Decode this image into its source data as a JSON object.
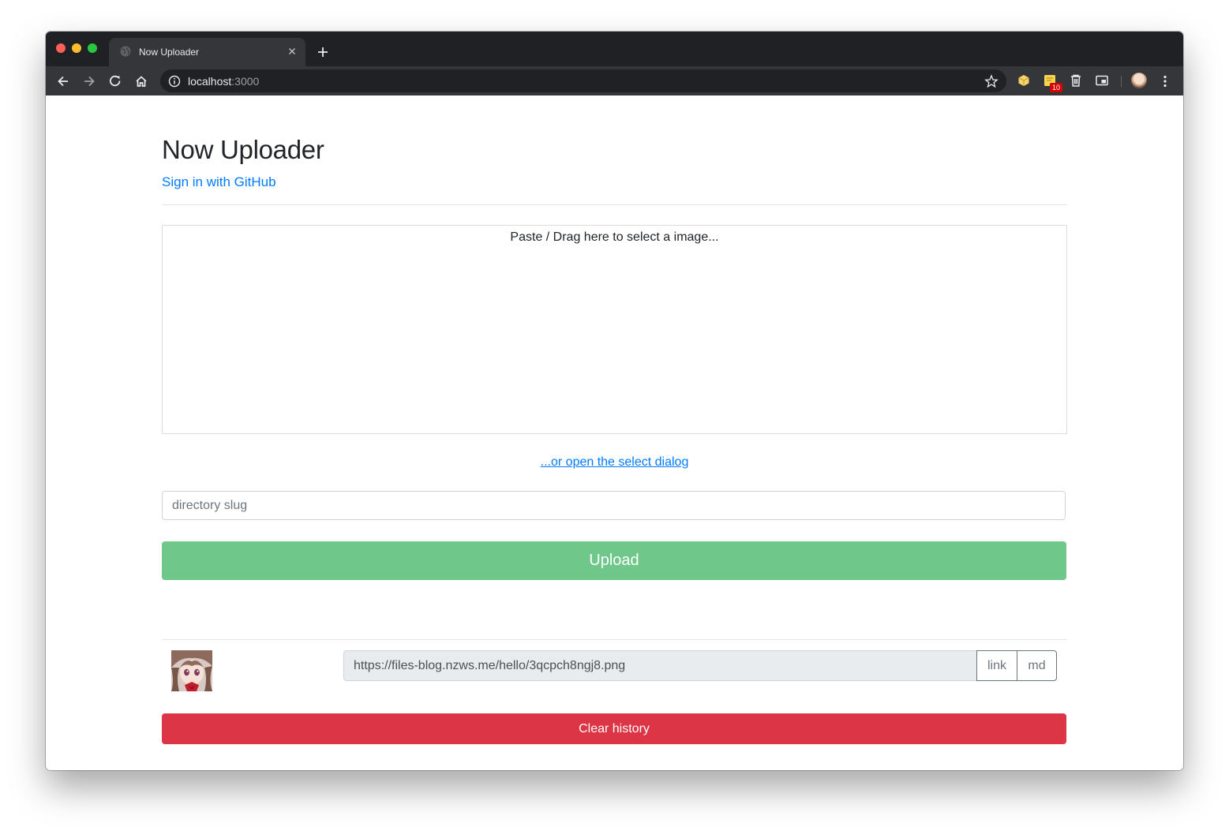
{
  "browser": {
    "tab_title": "Now Uploader",
    "url_host": "localhost",
    "url_port": ":3000",
    "extension_badge": "10",
    "icons": [
      "back-icon",
      "forward-icon",
      "reload-icon",
      "home-icon",
      "info-icon",
      "star-icon",
      "box-extension-icon",
      "notes-extension-icon",
      "trash-extension-icon",
      "pip-extension-icon",
      "profile-avatar",
      "menu-icon"
    ]
  },
  "page": {
    "title": "Now Uploader",
    "signin_link": "Sign in with GitHub",
    "dropzone_text": "Paste / Drag here to select a image...",
    "select_dialog_link": "...or open the select dialog",
    "slug_placeholder": "directory slug",
    "upload_label": "Upload",
    "history": [
      {
        "url": "https://files-blog.nzws.me/hello/3qcpch8ngj8.png",
        "link_label": "link",
        "md_label": "md"
      }
    ],
    "clear_label": "Clear history"
  },
  "colors": {
    "link": "#007bff",
    "upload": "#6fc789",
    "danger": "#dc3545",
    "chrome_dark": "#202124",
    "chrome_tab": "#35363a"
  }
}
